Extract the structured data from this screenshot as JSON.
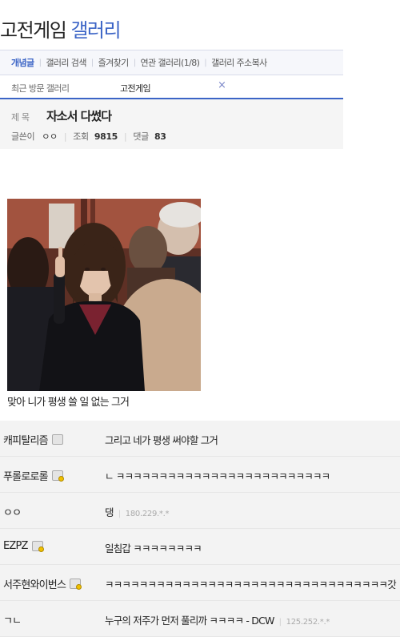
{
  "gallery": {
    "name_prefix": "고전게임",
    "name_suffix": "갤러리"
  },
  "tabs": [
    {
      "label": "개념글"
    },
    {
      "label": "갤러리 검색"
    },
    {
      "label": "즐겨찾기"
    },
    {
      "label": "연관 갤러리(1/8)"
    },
    {
      "label": "갤러리 주소복사"
    }
  ],
  "recent": {
    "label": "최근 방문 갤러리",
    "gallery": "고전게임",
    "close_glyph": "×"
  },
  "post": {
    "title_label": "제 목",
    "title": "자소서 다썼다",
    "author_label": "글쓴이",
    "author": "ㅇㅇ",
    "views_label": "조회",
    "views": "9815",
    "comments_label": "댓글",
    "comments": "83",
    "caption": "맞아 니가 평생 쓸 일 없는 그거"
  },
  "comments": [
    {
      "name": "캐피탈리즘",
      "badge": "fixed-nick-icon",
      "text": "그리고 네가 평생 써야할 그거",
      "ip": ""
    },
    {
      "name": "푸롤로로롤",
      "badge": "fixed-nick-gold-icon",
      "text": "ㄴ ㅋㅋㅋㅋㅋㅋㅋㅋㅋㅋㅋㅋㅋㅋㅋㅋㅋㅋㅋㅋㅋㅋㅋㅋㅋ",
      "ip": ""
    },
    {
      "name": "ㅇㅇ",
      "badge": "",
      "text": "댕",
      "ip": "180.229.*.*"
    },
    {
      "name": "EZPZ",
      "badge": "fixed-nick-gold-icon",
      "text": "일침갑 ㅋㅋㅋㅋㅋㅋㅋㅋ",
      "ip": ""
    },
    {
      "name": "서주현와이번스",
      "badge": "fixed-nick-gold-icon",
      "text": "ㅋㅋㅋㅋㅋㅋㅋㅋㅋㅋㅋㅋㅋㅋㅋㅋㅋㅋㅋㅋㅋㅋㅋㅋㅋㅋㅋㅋㅋㅋㅋㅋㅋ갓",
      "ip": ""
    },
    {
      "name": "ㄱㄴ",
      "badge": "",
      "text": "누구의 저주가 먼저 풀리까 ㅋㅋㅋㅋ - DCW",
      "ip": "125.252.*.*"
    }
  ]
}
